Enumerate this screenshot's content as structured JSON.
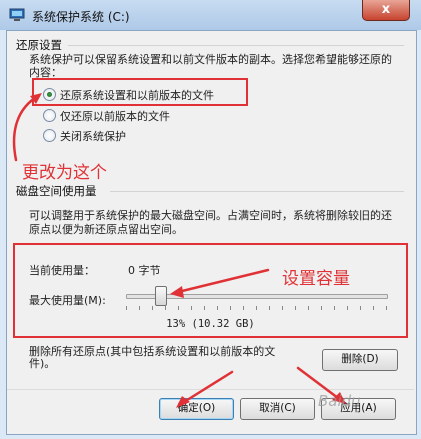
{
  "window": {
    "title": "系统保护系统 (C:)",
    "close_glyph": "x"
  },
  "restore": {
    "header": "还原设置",
    "description": "系统保护可以保留系统设置和以前文件版本的副本。选择您希望能够还原的内容：",
    "options": [
      {
        "label": "还原系统设置和以前版本的文件",
        "selected": true
      },
      {
        "label": "仅还原以前版本的文件",
        "selected": false
      },
      {
        "label": "关闭系统保护",
        "selected": false
      }
    ]
  },
  "disk": {
    "header": "磁盘空间使用量",
    "description": "可以调整用于系统保护的最大磁盘空间。占满空间时，系统将删除较旧的还原点以便为新还原点留出空间。",
    "current_label": "当前使用量：",
    "current_value": "0 字节",
    "max_label": "最大使用量(M):",
    "max_fraction": 0.13,
    "max_readout": "13% (10.32 GB)"
  },
  "delete": {
    "description": "删除所有还原点(其中包括系统设置和以前版本的文件)。",
    "button": "删除(D)"
  },
  "footer": {
    "ok": "确定(O)",
    "cancel": "取消(C)",
    "apply": "应用(A)"
  },
  "annotations": {
    "change_to_this": "更改为这个",
    "set_capacity": "设置容量"
  },
  "watermark": "Baidu",
  "colors": {
    "annotation_red": "#e03236"
  }
}
